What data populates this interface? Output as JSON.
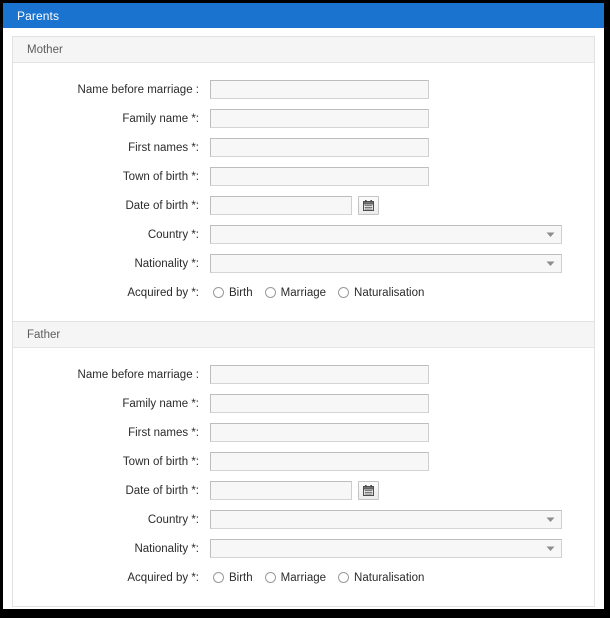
{
  "window": {
    "title": "Parents",
    "title_bar_color": "#1a73cf"
  },
  "labels": {
    "name_before_marriage": "Name before marriage :",
    "family_name": "Family name *:",
    "first_names": "First names *:",
    "town_of_birth": "Town of birth *:",
    "date_of_birth": "Date of birth *:",
    "country": "Country *:",
    "nationality": "Nationality *:",
    "acquired_by": "Acquired by *:"
  },
  "radio_options": {
    "birth": "Birth",
    "marriage": "Marriage",
    "naturalisation": "Naturalisation"
  },
  "sections": [
    {
      "id": "mother",
      "header": "Mother",
      "fields": {
        "name_before_marriage": "",
        "family_name": "",
        "first_names": "",
        "town_of_birth": "",
        "date_of_birth": "",
        "country": "",
        "nationality": "",
        "acquired_by": ""
      }
    },
    {
      "id": "father",
      "header": "Father",
      "fields": {
        "name_before_marriage": "",
        "family_name": "",
        "first_names": "",
        "town_of_birth": "",
        "date_of_birth": "",
        "country": "",
        "nationality": "",
        "acquired_by": ""
      }
    }
  ],
  "icons": {
    "calendar": "calendar-icon",
    "dropdown_arrow": "chevron-down-icon"
  },
  "placeholders": {
    "empty": ""
  }
}
